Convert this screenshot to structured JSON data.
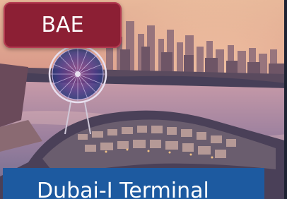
{
  "badge": {
    "label": "BAE",
    "color": "#8c1f34"
  },
  "title_bar": {
    "label": "Dubai-I Terminal",
    "color": "#1d5aa0"
  },
  "photo": {
    "icon": "dubai-skyline-ferris-wheel-image"
  }
}
